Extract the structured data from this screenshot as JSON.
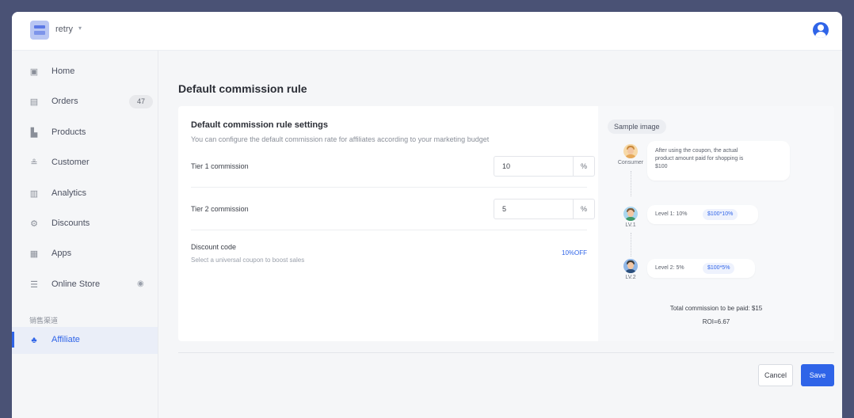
{
  "topbar": {
    "store_name": "retry",
    "store_caret": "▾",
    "store_icon": "store-icon",
    "avatar_icon": "user-avatar-icon"
  },
  "sidebar": {
    "items": [
      {
        "label": "Home",
        "icon": "home-icon"
      },
      {
        "label": "Orders",
        "icon": "orders-icon",
        "badge": "47"
      },
      {
        "label": "Products",
        "icon": "products-icon"
      },
      {
        "label": "Customer",
        "icon": "customer-icon"
      },
      {
        "label": "Analytics",
        "icon": "analytics-icon"
      },
      {
        "label": "Discounts",
        "icon": "discounts-icon"
      },
      {
        "label": "Apps",
        "icon": "apps-icon"
      },
      {
        "label": "Online Store",
        "icon": "online-store-icon"
      }
    ],
    "section_label": "销售渠道",
    "active_item": {
      "label": "Affiliate",
      "icon": "affiliate-icon"
    },
    "accent": "#2f64e8"
  },
  "main": {
    "page_title": "Default commission rule",
    "settings": {
      "title": "Default commission rule settings",
      "description": "You can configure the default commission rate for affiliates according to your marketing budget",
      "tier1": {
        "label": "Tier 1 commission",
        "value": "10",
        "suffix": "%"
      },
      "tier2": {
        "label": "Tier 2 commission",
        "value": "5",
        "suffix": "%"
      },
      "discount": {
        "title": "Discount code",
        "description": "Select a universal coupon to boost sales",
        "link": "10%OFF"
      }
    },
    "sample": {
      "tag": "Sample image",
      "consumer_label": "Consumer",
      "consumer_text_1": "After using the coupon, the actual",
      "consumer_text_2": "product amount paid for shopping is",
      "consumer_text_3": "$100",
      "lv1_label": "LV.1",
      "lv1_text": "Level 1: 10%",
      "lv1_calc": "$100*10%",
      "lv2_label": "LV.2",
      "lv2_text": "Level 2: 5%",
      "lv2_calc": "$100*5%",
      "total": "Total commission to be paid: $15",
      "roi": "ROI=6.67"
    }
  },
  "footer": {
    "cancel_label": "Cancel",
    "save_label": "Save"
  }
}
